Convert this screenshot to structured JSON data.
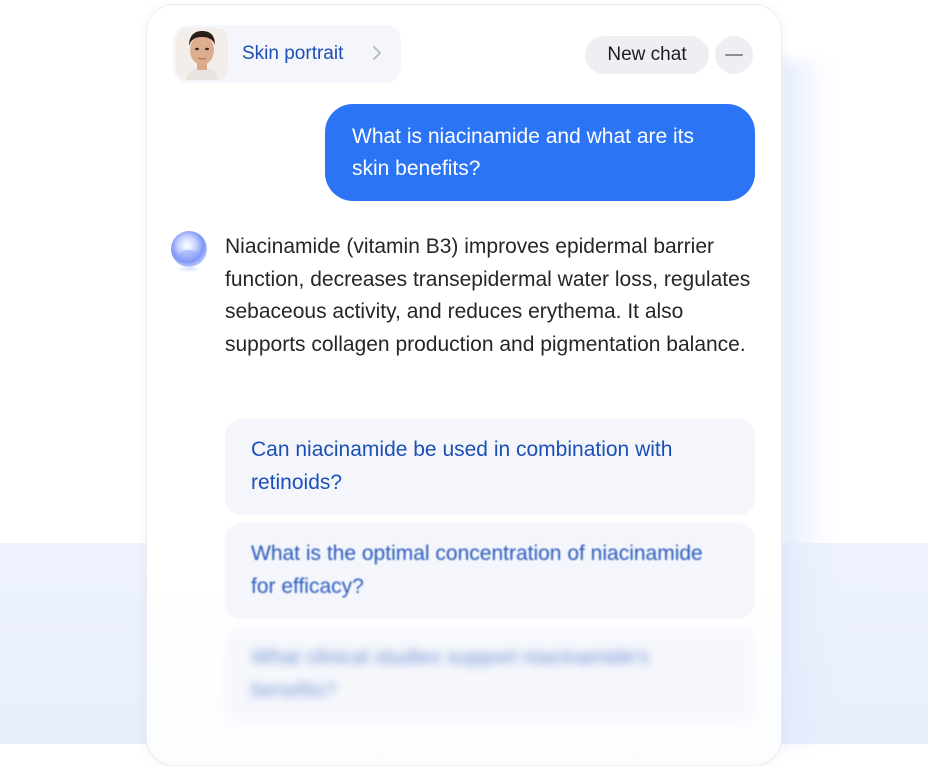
{
  "header": {
    "portrait_label": "Skin portrait",
    "new_chat_label": "New chat"
  },
  "conversation": {
    "user_message": "What is niacinamide and what are its skin benefits?",
    "assistant_message": "Niacinamide (vitamin B3) improves epidermal barrier function, decreases transepidermal water loss, regulates sebaceous activity, and reduces erythema. It also supports collagen production and pigmentation balance."
  },
  "suggestions": [
    {
      "label": "Can niacinamide be used in combination with retinoids?"
    },
    {
      "label": "What is the optimal concentration of niacinamide for efficacy?"
    },
    {
      "label": "What clinical studies support niacinamide's benefits?"
    }
  ],
  "colors": {
    "accent": "#2c74f6",
    "link_text": "#1b4fb8",
    "chip_bg": "#f4f6fc"
  },
  "icons": {
    "portrait": "face-photo-icon",
    "chevron": "chevron-right-icon",
    "minimize": "minus-icon",
    "assistant": "orb-avatar-icon"
  }
}
